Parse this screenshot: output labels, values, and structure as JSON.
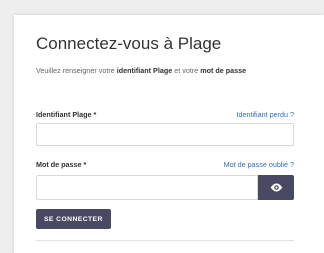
{
  "login": {
    "title": "Connectez-vous à Plage",
    "intro_prefix": "Veuillez renseigner votre ",
    "intro_bold1": "identifiant Plage",
    "intro_mid": " et votre ",
    "intro_bold2": "mot de passe",
    "identifiant_label": "Identifiant Plage *",
    "identifiant_lost_link": "Identifiant perdu ?",
    "identifiant_value": "",
    "password_label": "Mot de passe *",
    "password_forgot_link": "Mot de passe oublié ?",
    "password_value": "",
    "toggle_icon": "eye-icon",
    "submit_label": "SE CONNECTER"
  },
  "colors": {
    "accent": "#494963",
    "link": "#2f6fc0"
  }
}
